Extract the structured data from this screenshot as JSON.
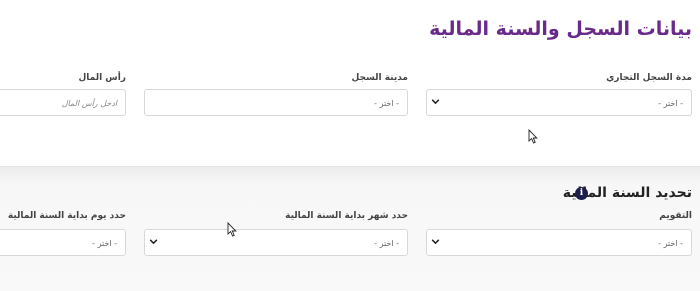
{
  "page": {
    "title": "بيانات السجل والسنة المالية"
  },
  "registry": {
    "duration": {
      "label": "مدة السجل التجاري",
      "value": "- اختر -"
    },
    "city": {
      "label": "مدينة السجل",
      "value": "- اختر -"
    },
    "capital": {
      "label": "رأس المال",
      "placeholder": "ادخل رأس المال"
    }
  },
  "fiscal": {
    "title": "تحديد السنة المالية",
    "info_icon_glyph": "i",
    "calendar": {
      "label": "التقويم",
      "value": "- اختر -"
    },
    "start_month": {
      "label": "حدد شهر بداية السنة المالية",
      "value": "- اختر -"
    },
    "start_day": {
      "label": "حدد يوم بداية السنة المالية",
      "value": "- اختر -"
    }
  },
  "icons": {
    "dropdown": "chevron-down-icon",
    "info": "info-icon",
    "cursor": "mouse-pointer-icon"
  },
  "colors": {
    "title": "#6a2a8a",
    "info_icon_bg": "#1e1e4a",
    "section_bg": "#f7f7f7",
    "border": "#d8d8d8"
  }
}
